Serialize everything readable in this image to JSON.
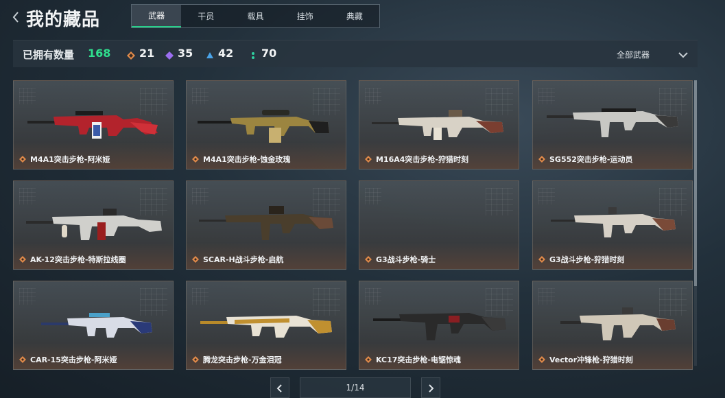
{
  "header": {
    "title": "我的藏品",
    "tabs": [
      {
        "label": "武器",
        "active": true
      },
      {
        "label": "干员",
        "active": false
      },
      {
        "label": "载具",
        "active": false
      },
      {
        "label": "挂饰",
        "active": false
      },
      {
        "label": "典藏",
        "active": false
      }
    ]
  },
  "stats": {
    "owned_label": "已拥有数量",
    "owned_count": "168",
    "orange_count": "21",
    "purple_count": "35",
    "blue_count": "42",
    "green_count": "70",
    "filter_label": "全部武器"
  },
  "colors": {
    "accent_green": "#2fe08e",
    "rarity_orange": "#e08a4a",
    "rarity_purple": "#9b6ef0",
    "rarity_blue": "#4aa3e8",
    "rarity_green": "#2fd0a0"
  },
  "items": [
    {
      "name": "M4A1突击步枪-阿米娅",
      "icon": "rifle-icon"
    },
    {
      "name": "M4A1突击步枪-蚀金玫瑰",
      "icon": "rifle-icon"
    },
    {
      "name": "M16A4突击步枪-狩猎时刻",
      "icon": "rifle-icon"
    },
    {
      "name": "SG552突击步枪-运动员",
      "icon": "rifle-icon"
    },
    {
      "name": "AK-12突击步枪-特斯拉线圈",
      "icon": "rifle-icon"
    },
    {
      "name": "SCAR-H战斗步枪-启航",
      "icon": "rifle-icon"
    },
    {
      "name": "G3战斗步枪-骑士",
      "icon": "rifle-icon"
    },
    {
      "name": "G3战斗步枪-狩猎时刻",
      "icon": "rifle-icon"
    },
    {
      "name": "CAR-15突击步枪-阿米娅",
      "icon": "rifle-icon"
    },
    {
      "name": "腾龙突击步枪-万金泪冠",
      "icon": "rifle-icon"
    },
    {
      "name": "KC17突击步枪-电锯惊魂",
      "icon": "rifle-icon"
    },
    {
      "name": "Vector冲锋枪-狩猎时刻",
      "icon": "smg-icon"
    }
  ],
  "pagination": {
    "page_label": "1/14"
  }
}
